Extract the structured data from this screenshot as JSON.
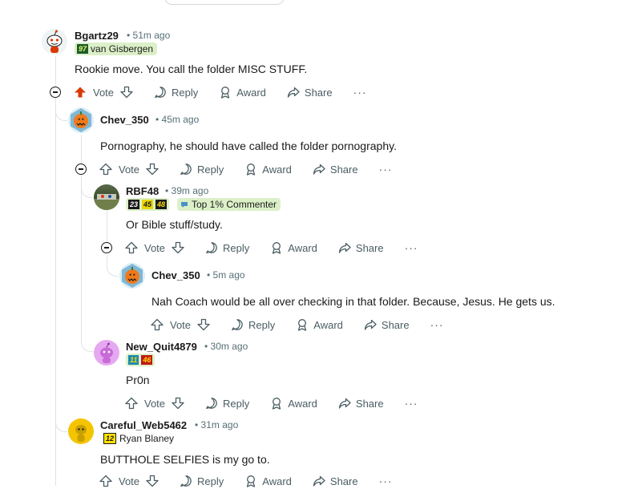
{
  "comments": [
    {
      "username": "Bgartz29",
      "time": "51m ago",
      "flair": {
        "badge": "97",
        "text": "van Gisbergen"
      },
      "text": "Rookie move. You call the folder MISC STUFF.",
      "upvoted": true
    },
    {
      "username": "Chev_350",
      "time": "45m ago",
      "text": "Pornography, he should have called the folder pornography."
    },
    {
      "username": "RBF48",
      "time": "39m ago",
      "flair": {
        "badges": [
          "23",
          "45",
          "48"
        ],
        "text": "Top 1% Commenter"
      },
      "text": "Or Bible stuff/study."
    },
    {
      "username": "Chev_350",
      "time": "5m ago",
      "text": "Nah Coach would be all over checking in that folder. Because, Jesus. He gets us."
    },
    {
      "username": "New_Quit4879",
      "time": "30m ago",
      "flair": {
        "badges": [
          "11",
          "46"
        ]
      },
      "text": "Pr0n"
    },
    {
      "username": "Careful_Web5462",
      "time": "31m ago",
      "flair": {
        "badge": "12",
        "text": "Ryan Blaney"
      },
      "text": "BUTTHOLE SELFIES is my go to."
    }
  ],
  "actions": {
    "vote": "Vote",
    "reply": "Reply",
    "award": "Award",
    "share": "Share",
    "more": "···"
  },
  "separator": "•",
  "colors": {
    "upvote": "#d93a00",
    "flair_bg": "#dcf0c8",
    "meta": "#576f76",
    "thread_line": "#dfe3e6"
  }
}
